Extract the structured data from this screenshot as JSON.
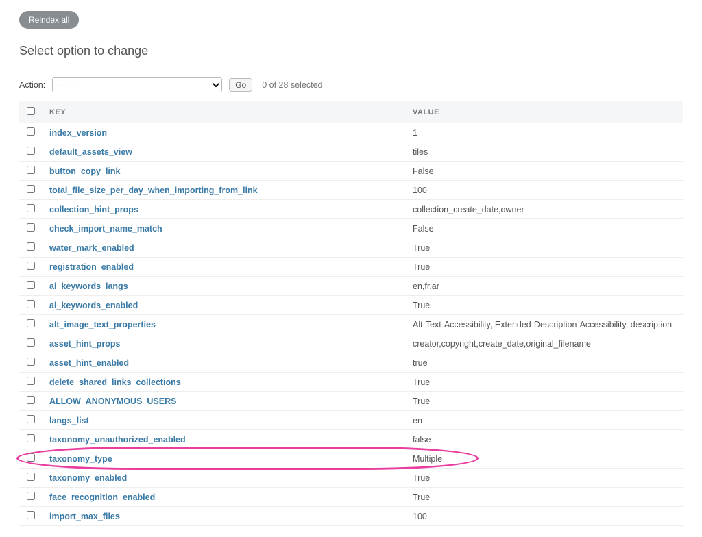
{
  "header": {
    "reindex_button": "Reindex all",
    "title": "Select option to change"
  },
  "action_bar": {
    "label": "Action:",
    "placeholder": "---------",
    "go_label": "Go",
    "selection_text": "0 of 28 selected"
  },
  "table": {
    "headers": {
      "key": "KEY",
      "value": "VALUE"
    },
    "rows": [
      {
        "key": "index_version",
        "value": "1"
      },
      {
        "key": "default_assets_view",
        "value": "tiles"
      },
      {
        "key": "button_copy_link",
        "value": "False"
      },
      {
        "key": "total_file_size_per_day_when_importing_from_link",
        "value": "100"
      },
      {
        "key": "collection_hint_props",
        "value": "collection_create_date,owner"
      },
      {
        "key": "check_import_name_match",
        "value": "False"
      },
      {
        "key": "water_mark_enabled",
        "value": "True"
      },
      {
        "key": "registration_enabled",
        "value": "True"
      },
      {
        "key": "ai_keywords_langs",
        "value": "en,fr,ar"
      },
      {
        "key": "ai_keywords_enabled",
        "value": "True"
      },
      {
        "key": "alt_image_text_properties",
        "value": "Alt-Text-Accessibility, Extended-Description-Accessibility, description"
      },
      {
        "key": "asset_hint_props",
        "value": "creator,copyright,create_date,original_filename"
      },
      {
        "key": "asset_hint_enabled",
        "value": "true"
      },
      {
        "key": "delete_shared_links_collections",
        "value": "True"
      },
      {
        "key": "ALLOW_ANONYMOUS_USERS",
        "value": "True"
      },
      {
        "key": "langs_list",
        "value": "en"
      },
      {
        "key": "taxonomy_unauthorized_enabled",
        "value": "false"
      },
      {
        "key": "taxonomy_type",
        "value": "Multiple",
        "highlight": true
      },
      {
        "key": "taxonomy_enabled",
        "value": "True"
      },
      {
        "key": "face_recognition_enabled",
        "value": "True"
      },
      {
        "key": "import_max_files",
        "value": "100"
      }
    ]
  }
}
